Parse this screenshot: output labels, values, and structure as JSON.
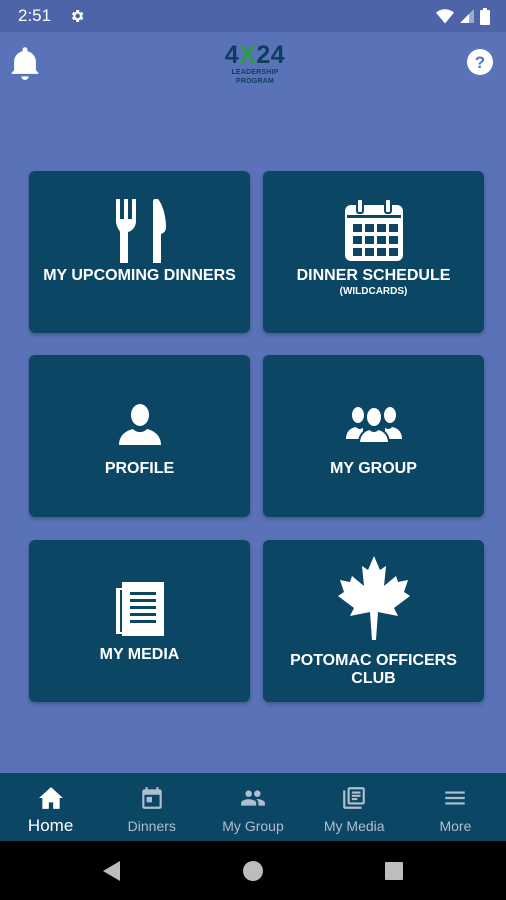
{
  "status_bar": {
    "time": "2:51"
  },
  "logo": {
    "part1": "4",
    "part2": "X",
    "part3": "24",
    "subtitle": "LEADERSHIP PROGRAM"
  },
  "tiles": [
    {
      "label": "MY UPCOMING DINNERS",
      "sublabel": "",
      "icon": "fork-knife-icon"
    },
    {
      "label": "DINNER SCHEDULE",
      "sublabel": "(WILDCARDS)",
      "icon": "calendar-icon"
    },
    {
      "label": "PROFILE",
      "sublabel": "",
      "icon": "person-icon"
    },
    {
      "label": "MY GROUP",
      "sublabel": "",
      "icon": "group-icon"
    },
    {
      "label": "MY MEDIA",
      "sublabel": "",
      "icon": "newspaper-icon"
    },
    {
      "label": "POTOMAC OFFICERS CLUB",
      "sublabel": "",
      "icon": "maple-leaf-icon"
    }
  ],
  "bottom_nav": [
    {
      "label": "Home",
      "icon": "home-icon",
      "active": true
    },
    {
      "label": "Dinners",
      "icon": "calendar-icon",
      "active": false
    },
    {
      "label": "My Group",
      "icon": "group-icon",
      "active": false
    },
    {
      "label": "My Media",
      "icon": "newspaper-icon",
      "active": false
    },
    {
      "label": "More",
      "icon": "menu-icon",
      "active": false
    }
  ],
  "colors": {
    "background": "#5a72b8",
    "status_bar": "#4d65a8",
    "tile": "#0c4665",
    "nav": "#0c4665",
    "logo_green": "#2e9a46",
    "logo_navy": "#0e3e5e"
  }
}
